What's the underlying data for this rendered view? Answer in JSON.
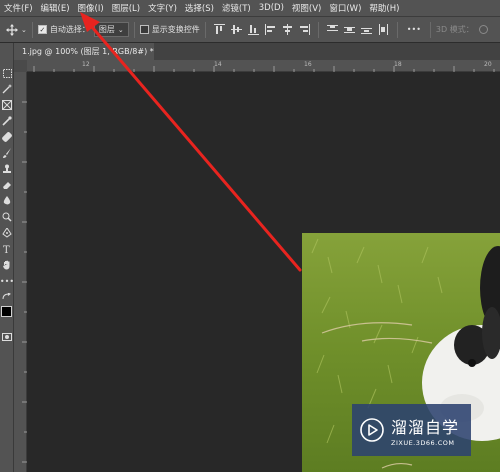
{
  "menu": [
    "文件(F)",
    "编辑(E)",
    "图像(I)",
    "图层(L)",
    "文字(Y)",
    "选择(S)",
    "滤镜(T)",
    "3D(D)",
    "视图(V)",
    "窗口(W)",
    "帮助(H)"
  ],
  "options": {
    "auto_select_label": "自动选择：",
    "auto_select_target": "图层",
    "show_transform_label": "显示变换控件",
    "more_label": "•••",
    "mode_3d_label": "3D 模式："
  },
  "document_tab": {
    "title": "1.jpg @ 100% (图层 1, RGB/8#) *"
  },
  "ruler_top_ticks": [
    "12",
    "14",
    "16",
    "18",
    "20"
  ],
  "watermark": {
    "title": "溜溜自学",
    "url": "ZIXUE.3D66.COM"
  },
  "colors": {
    "annotation_arrow": "#e8241f",
    "ui_panel": "#535353",
    "canvas_bg": "#282828",
    "watermark_bg": "#2c4270"
  }
}
